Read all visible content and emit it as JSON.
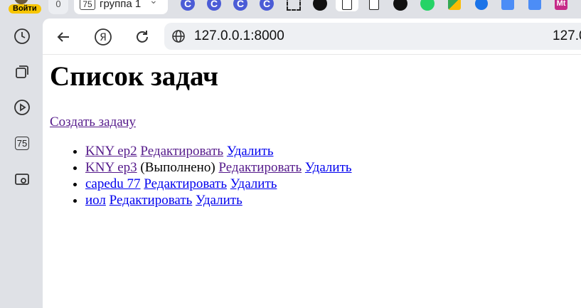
{
  "browser": {
    "profile_button_label": "Войти",
    "tab_count": "0",
    "tab_group": {
      "number": "75",
      "label": "группа 1"
    },
    "address": "127.0.0.1:8000",
    "address_right_fragment": "127.0",
    "tab_icons": [
      {
        "icon": "c-icon",
        "char": "C"
      },
      {
        "icon": "c-icon",
        "char": "C"
      },
      {
        "icon": "c-icon",
        "char": "C"
      },
      {
        "icon": "c-icon",
        "char": "C"
      },
      {
        "icon": "screenshot-frame-icon",
        "char": ""
      },
      {
        "icon": "dark-circle-icon",
        "char": ""
      },
      {
        "icon": "document-icon",
        "char": ""
      },
      {
        "icon": "document-icon",
        "char": ""
      },
      {
        "icon": "dark-circle-icon",
        "char": ""
      },
      {
        "icon": "whatsapp-icon",
        "char": ""
      },
      {
        "icon": "google-meet-icon",
        "char": ""
      },
      {
        "icon": "arrow-app-icon",
        "char": ""
      },
      {
        "icon": "blue-cube-icon",
        "char": ""
      },
      {
        "icon": "blue-cube-icon",
        "char": ""
      },
      {
        "icon": "mt-icon",
        "char": "Mt"
      }
    ],
    "sidebar_badge": "75"
  },
  "page": {
    "title": "Список задач",
    "create_link": "Создать задачу",
    "tasks": [
      {
        "name": "KNY ep2",
        "status": "",
        "edit": "Редактировать",
        "delete": "Удалить"
      },
      {
        "name": "KNY ep3",
        "status": "(Выполнено)",
        "edit": "Редактировать",
        "delete": "Удалить"
      },
      {
        "name": "capedu 77",
        "status": "",
        "edit": "Редактировать",
        "delete": "Удалить"
      },
      {
        "name": "иол",
        "status": "",
        "edit": "Редактировать",
        "delete": "Удалить"
      }
    ]
  },
  "colors": {
    "visited_link": "#551a8b",
    "unvisited_link": "#0000ee",
    "chrome_bg": "#dfe1e6",
    "accent_badge": "#f7c500"
  }
}
